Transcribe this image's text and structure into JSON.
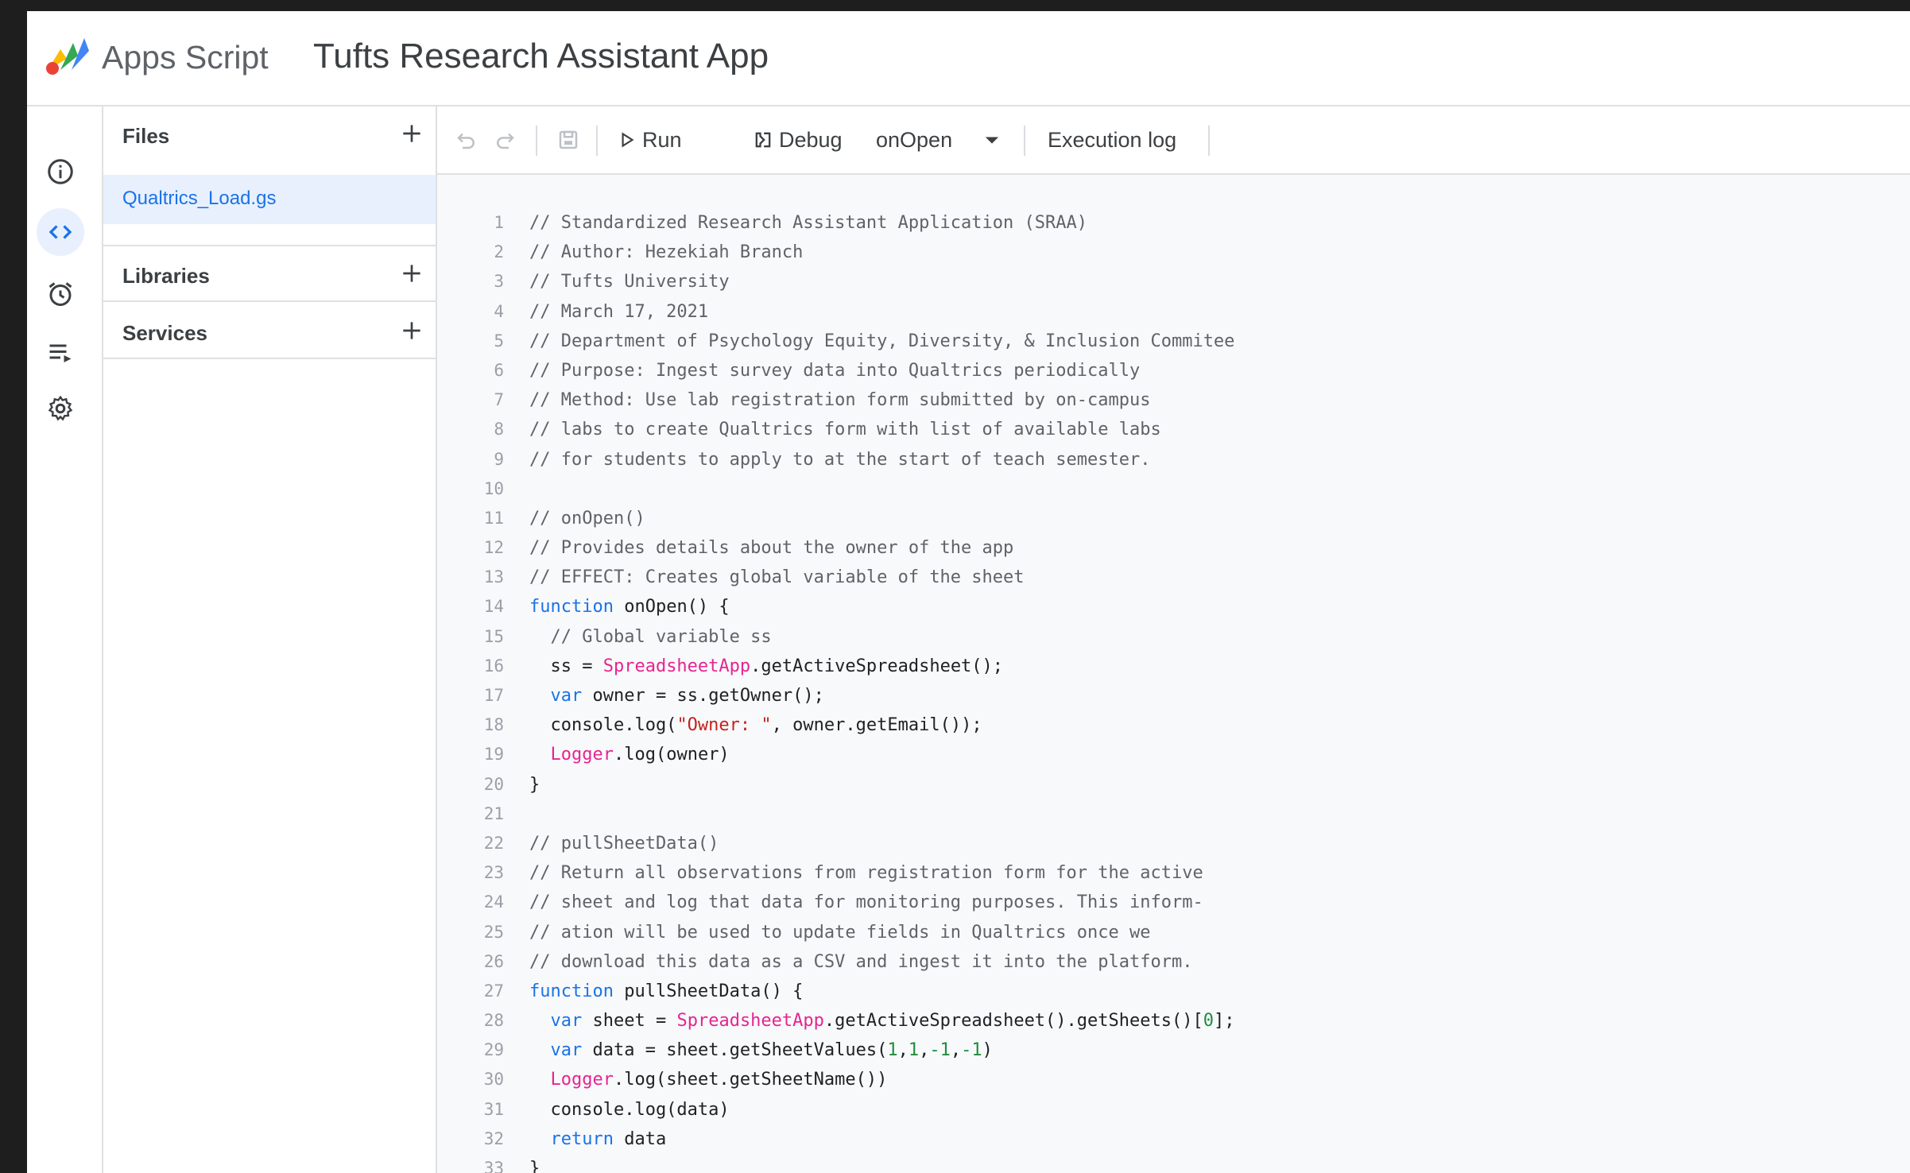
{
  "header": {
    "product_name": "Apps Script",
    "project_title": "Tufts Research Assistant App",
    "logo_colors": [
      "#4285f4",
      "#34a853",
      "#fbbc04",
      "#ea4335"
    ]
  },
  "rail": {
    "items": [
      {
        "name": "overview",
        "icon": "info-icon",
        "active": false
      },
      {
        "name": "editor",
        "icon": "code-icon",
        "active": true
      },
      {
        "name": "triggers",
        "icon": "alarm-icon",
        "active": false
      },
      {
        "name": "executions",
        "icon": "executions-icon",
        "active": false
      },
      {
        "name": "settings",
        "icon": "gear-icon",
        "active": false
      }
    ]
  },
  "panel": {
    "files_label": "Files",
    "files": [
      {
        "name": "Qualtrics_Load.gs",
        "selected": true
      }
    ],
    "libraries_label": "Libraries",
    "services_label": "Services"
  },
  "toolbar": {
    "run_label": "Run",
    "debug_label": "Debug",
    "function_selected": "onOpen",
    "execution_log_label": "Execution log"
  },
  "colors": {
    "accent": "#1a73e8",
    "selection_bg": "#e8f0fe",
    "keyword": "#1a73e8",
    "class_name": "#e52592",
    "string": "#c5221f",
    "number": "#1e8e3e",
    "comment": "#5f6368"
  },
  "code": {
    "lines": [
      {
        "n": "1",
        "tokens": [
          {
            "t": "// Standardized Research Assistant Application (SRAA)",
            "c": "comment"
          }
        ]
      },
      {
        "n": "2",
        "tokens": [
          {
            "t": "// Author: Hezekiah Branch",
            "c": "comment"
          }
        ]
      },
      {
        "n": "3",
        "tokens": [
          {
            "t": "// Tufts University",
            "c": "comment"
          }
        ]
      },
      {
        "n": "4",
        "tokens": [
          {
            "t": "// March 17, 2021",
            "c": "comment"
          }
        ]
      },
      {
        "n": "5",
        "tokens": [
          {
            "t": "// Department of Psychology Equity, Diversity, & Inclusion Commitee",
            "c": "comment"
          }
        ]
      },
      {
        "n": "6",
        "tokens": [
          {
            "t": "// Purpose: Ingest survey data into Qualtrics periodically",
            "c": "comment"
          }
        ]
      },
      {
        "n": "7",
        "tokens": [
          {
            "t": "// Method: Use lab registration form submitted by on-campus",
            "c": "comment"
          }
        ]
      },
      {
        "n": "8",
        "tokens": [
          {
            "t": "// labs to create Qualtrics form with list of available labs",
            "c": "comment"
          }
        ]
      },
      {
        "n": "9",
        "tokens": [
          {
            "t": "// for students to apply to at the start of teach semester.",
            "c": "comment"
          }
        ]
      },
      {
        "n": "10",
        "tokens": []
      },
      {
        "n": "11",
        "tokens": [
          {
            "t": "// onOpen()",
            "c": "comment"
          }
        ]
      },
      {
        "n": "12",
        "tokens": [
          {
            "t": "// Provides details about the owner of the app",
            "c": "comment"
          }
        ]
      },
      {
        "n": "13",
        "tokens": [
          {
            "t": "// EFFECT: Creates global variable of the sheet",
            "c": "comment"
          }
        ]
      },
      {
        "n": "14",
        "tokens": [
          {
            "t": "function",
            "c": "keyword"
          },
          {
            "t": " onOpen() {",
            "c": "plain"
          }
        ]
      },
      {
        "n": "15",
        "tokens": [
          {
            "t": "  // Global variable ss",
            "c": "comment"
          }
        ]
      },
      {
        "n": "16",
        "tokens": [
          {
            "t": "  ss = ",
            "c": "plain"
          },
          {
            "t": "SpreadsheetApp",
            "c": "class"
          },
          {
            "t": ".getActiveSpreadsheet();",
            "c": "plain"
          }
        ]
      },
      {
        "n": "17",
        "tokens": [
          {
            "t": "  ",
            "c": "plain"
          },
          {
            "t": "var",
            "c": "keyword"
          },
          {
            "t": " owner = ss.getOwner();",
            "c": "plain"
          }
        ]
      },
      {
        "n": "18",
        "tokens": [
          {
            "t": "  console.log(",
            "c": "plain"
          },
          {
            "t": "\"Owner: \"",
            "c": "string"
          },
          {
            "t": ", owner.getEmail());",
            "c": "plain"
          }
        ]
      },
      {
        "n": "19",
        "tokens": [
          {
            "t": "  ",
            "c": "plain"
          },
          {
            "t": "Logger",
            "c": "class"
          },
          {
            "t": ".log(owner)",
            "c": "plain"
          }
        ]
      },
      {
        "n": "20",
        "tokens": [
          {
            "t": "}",
            "c": "plain"
          }
        ]
      },
      {
        "n": "21",
        "tokens": []
      },
      {
        "n": "22",
        "tokens": [
          {
            "t": "// pullSheetData()",
            "c": "comment"
          }
        ]
      },
      {
        "n": "23",
        "tokens": [
          {
            "t": "// Return all observations from registration form for the active",
            "c": "comment"
          }
        ]
      },
      {
        "n": "24",
        "tokens": [
          {
            "t": "// sheet and log that data for monitoring purposes. This inform-",
            "c": "comment"
          }
        ]
      },
      {
        "n": "25",
        "tokens": [
          {
            "t": "// ation will be used to update fields in Qualtrics once we",
            "c": "comment"
          }
        ]
      },
      {
        "n": "26",
        "tokens": [
          {
            "t": "// download this data as a CSV and ingest it into the platform.",
            "c": "comment"
          }
        ]
      },
      {
        "n": "27",
        "tokens": [
          {
            "t": "function",
            "c": "keyword"
          },
          {
            "t": " pullSheetData() {",
            "c": "plain"
          }
        ]
      },
      {
        "n": "28",
        "tokens": [
          {
            "t": "  ",
            "c": "plain"
          },
          {
            "t": "var",
            "c": "keyword"
          },
          {
            "t": " sheet = ",
            "c": "plain"
          },
          {
            "t": "SpreadsheetApp",
            "c": "class"
          },
          {
            "t": ".getActiveSpreadsheet().getSheets()[",
            "c": "plain"
          },
          {
            "t": "0",
            "c": "number"
          },
          {
            "t": "];",
            "c": "plain"
          }
        ]
      },
      {
        "n": "29",
        "tokens": [
          {
            "t": "  ",
            "c": "plain"
          },
          {
            "t": "var",
            "c": "keyword"
          },
          {
            "t": " data = sheet.getSheetValues(",
            "c": "plain"
          },
          {
            "t": "1",
            "c": "number"
          },
          {
            "t": ",",
            "c": "plain"
          },
          {
            "t": "1",
            "c": "number"
          },
          {
            "t": ",",
            "c": "plain"
          },
          {
            "t": "-1",
            "c": "number"
          },
          {
            "t": ",",
            "c": "plain"
          },
          {
            "t": "-1",
            "c": "number"
          },
          {
            "t": ")",
            "c": "plain"
          }
        ]
      },
      {
        "n": "30",
        "tokens": [
          {
            "t": "  ",
            "c": "plain"
          },
          {
            "t": "Logger",
            "c": "class"
          },
          {
            "t": ".log(sheet.getSheetName())",
            "c": "plain"
          }
        ]
      },
      {
        "n": "31",
        "tokens": [
          {
            "t": "  console.log(data)",
            "c": "plain"
          }
        ]
      },
      {
        "n": "32",
        "tokens": [
          {
            "t": "  ",
            "c": "plain"
          },
          {
            "t": "return",
            "c": "keyword"
          },
          {
            "t": " data",
            "c": "plain"
          }
        ]
      },
      {
        "n": "33",
        "tokens": [
          {
            "t": "}",
            "c": "plain"
          }
        ]
      }
    ]
  }
}
